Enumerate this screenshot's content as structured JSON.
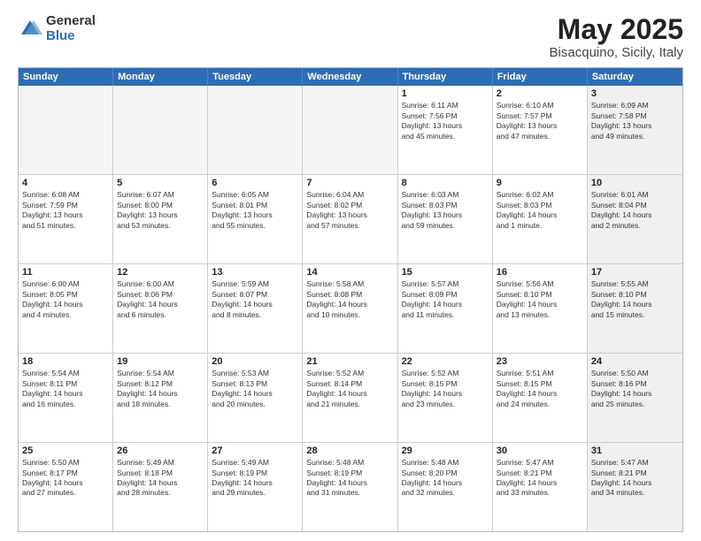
{
  "logo": {
    "general": "General",
    "blue": "Blue"
  },
  "header": {
    "month": "May 2025",
    "location": "Bisacquino, Sicily, Italy"
  },
  "weekdays": [
    "Sunday",
    "Monday",
    "Tuesday",
    "Wednesday",
    "Thursday",
    "Friday",
    "Saturday"
  ],
  "rows": [
    [
      {
        "day": "",
        "info": "",
        "empty": true
      },
      {
        "day": "",
        "info": "",
        "empty": true
      },
      {
        "day": "",
        "info": "",
        "empty": true
      },
      {
        "day": "",
        "info": "",
        "empty": true
      },
      {
        "day": "1",
        "info": "Sunrise: 6:11 AM\nSunset: 7:56 PM\nDaylight: 13 hours\nand 45 minutes."
      },
      {
        "day": "2",
        "info": "Sunrise: 6:10 AM\nSunset: 7:57 PM\nDaylight: 13 hours\nand 47 minutes."
      },
      {
        "day": "3",
        "info": "Sunrise: 6:09 AM\nSunset: 7:58 PM\nDaylight: 13 hours\nand 49 minutes.",
        "shaded": true
      }
    ],
    [
      {
        "day": "4",
        "info": "Sunrise: 6:08 AM\nSunset: 7:59 PM\nDaylight: 13 hours\nand 51 minutes."
      },
      {
        "day": "5",
        "info": "Sunrise: 6:07 AM\nSunset: 8:00 PM\nDaylight: 13 hours\nand 53 minutes."
      },
      {
        "day": "6",
        "info": "Sunrise: 6:05 AM\nSunset: 8:01 PM\nDaylight: 13 hours\nand 55 minutes."
      },
      {
        "day": "7",
        "info": "Sunrise: 6:04 AM\nSunset: 8:02 PM\nDaylight: 13 hours\nand 57 minutes."
      },
      {
        "day": "8",
        "info": "Sunrise: 6:03 AM\nSunset: 8:03 PM\nDaylight: 13 hours\nand 59 minutes."
      },
      {
        "day": "9",
        "info": "Sunrise: 6:02 AM\nSunset: 8:03 PM\nDaylight: 14 hours\nand 1 minute."
      },
      {
        "day": "10",
        "info": "Sunrise: 6:01 AM\nSunset: 8:04 PM\nDaylight: 14 hours\nand 2 minutes.",
        "shaded": true
      }
    ],
    [
      {
        "day": "11",
        "info": "Sunrise: 6:00 AM\nSunset: 8:05 PM\nDaylight: 14 hours\nand 4 minutes."
      },
      {
        "day": "12",
        "info": "Sunrise: 6:00 AM\nSunset: 8:06 PM\nDaylight: 14 hours\nand 6 minutes."
      },
      {
        "day": "13",
        "info": "Sunrise: 5:59 AM\nSunset: 8:07 PM\nDaylight: 14 hours\nand 8 minutes."
      },
      {
        "day": "14",
        "info": "Sunrise: 5:58 AM\nSunset: 8:08 PM\nDaylight: 14 hours\nand 10 minutes."
      },
      {
        "day": "15",
        "info": "Sunrise: 5:57 AM\nSunset: 8:09 PM\nDaylight: 14 hours\nand 11 minutes."
      },
      {
        "day": "16",
        "info": "Sunrise: 5:56 AM\nSunset: 8:10 PM\nDaylight: 14 hours\nand 13 minutes."
      },
      {
        "day": "17",
        "info": "Sunrise: 5:55 AM\nSunset: 8:10 PM\nDaylight: 14 hours\nand 15 minutes.",
        "shaded": true
      }
    ],
    [
      {
        "day": "18",
        "info": "Sunrise: 5:54 AM\nSunset: 8:11 PM\nDaylight: 14 hours\nand 16 minutes."
      },
      {
        "day": "19",
        "info": "Sunrise: 5:54 AM\nSunset: 8:12 PM\nDaylight: 14 hours\nand 18 minutes."
      },
      {
        "day": "20",
        "info": "Sunrise: 5:53 AM\nSunset: 8:13 PM\nDaylight: 14 hours\nand 20 minutes."
      },
      {
        "day": "21",
        "info": "Sunrise: 5:52 AM\nSunset: 8:14 PM\nDaylight: 14 hours\nand 21 minutes."
      },
      {
        "day": "22",
        "info": "Sunrise: 5:52 AM\nSunset: 8:15 PM\nDaylight: 14 hours\nand 23 minutes."
      },
      {
        "day": "23",
        "info": "Sunrise: 5:51 AM\nSunset: 8:15 PM\nDaylight: 14 hours\nand 24 minutes."
      },
      {
        "day": "24",
        "info": "Sunrise: 5:50 AM\nSunset: 8:16 PM\nDaylight: 14 hours\nand 25 minutes.",
        "shaded": true
      }
    ],
    [
      {
        "day": "25",
        "info": "Sunrise: 5:50 AM\nSunset: 8:17 PM\nDaylight: 14 hours\nand 27 minutes."
      },
      {
        "day": "26",
        "info": "Sunrise: 5:49 AM\nSunset: 8:18 PM\nDaylight: 14 hours\nand 28 minutes."
      },
      {
        "day": "27",
        "info": "Sunrise: 5:49 AM\nSunset: 8:19 PM\nDaylight: 14 hours\nand 29 minutes."
      },
      {
        "day": "28",
        "info": "Sunrise: 5:48 AM\nSunset: 8:19 PM\nDaylight: 14 hours\nand 31 minutes."
      },
      {
        "day": "29",
        "info": "Sunrise: 5:48 AM\nSunset: 8:20 PM\nDaylight: 14 hours\nand 32 minutes."
      },
      {
        "day": "30",
        "info": "Sunrise: 5:47 AM\nSunset: 8:21 PM\nDaylight: 14 hours\nand 33 minutes."
      },
      {
        "day": "31",
        "info": "Sunrise: 5:47 AM\nSunset: 8:21 PM\nDaylight: 14 hours\nand 34 minutes.",
        "shaded": true
      }
    ]
  ]
}
